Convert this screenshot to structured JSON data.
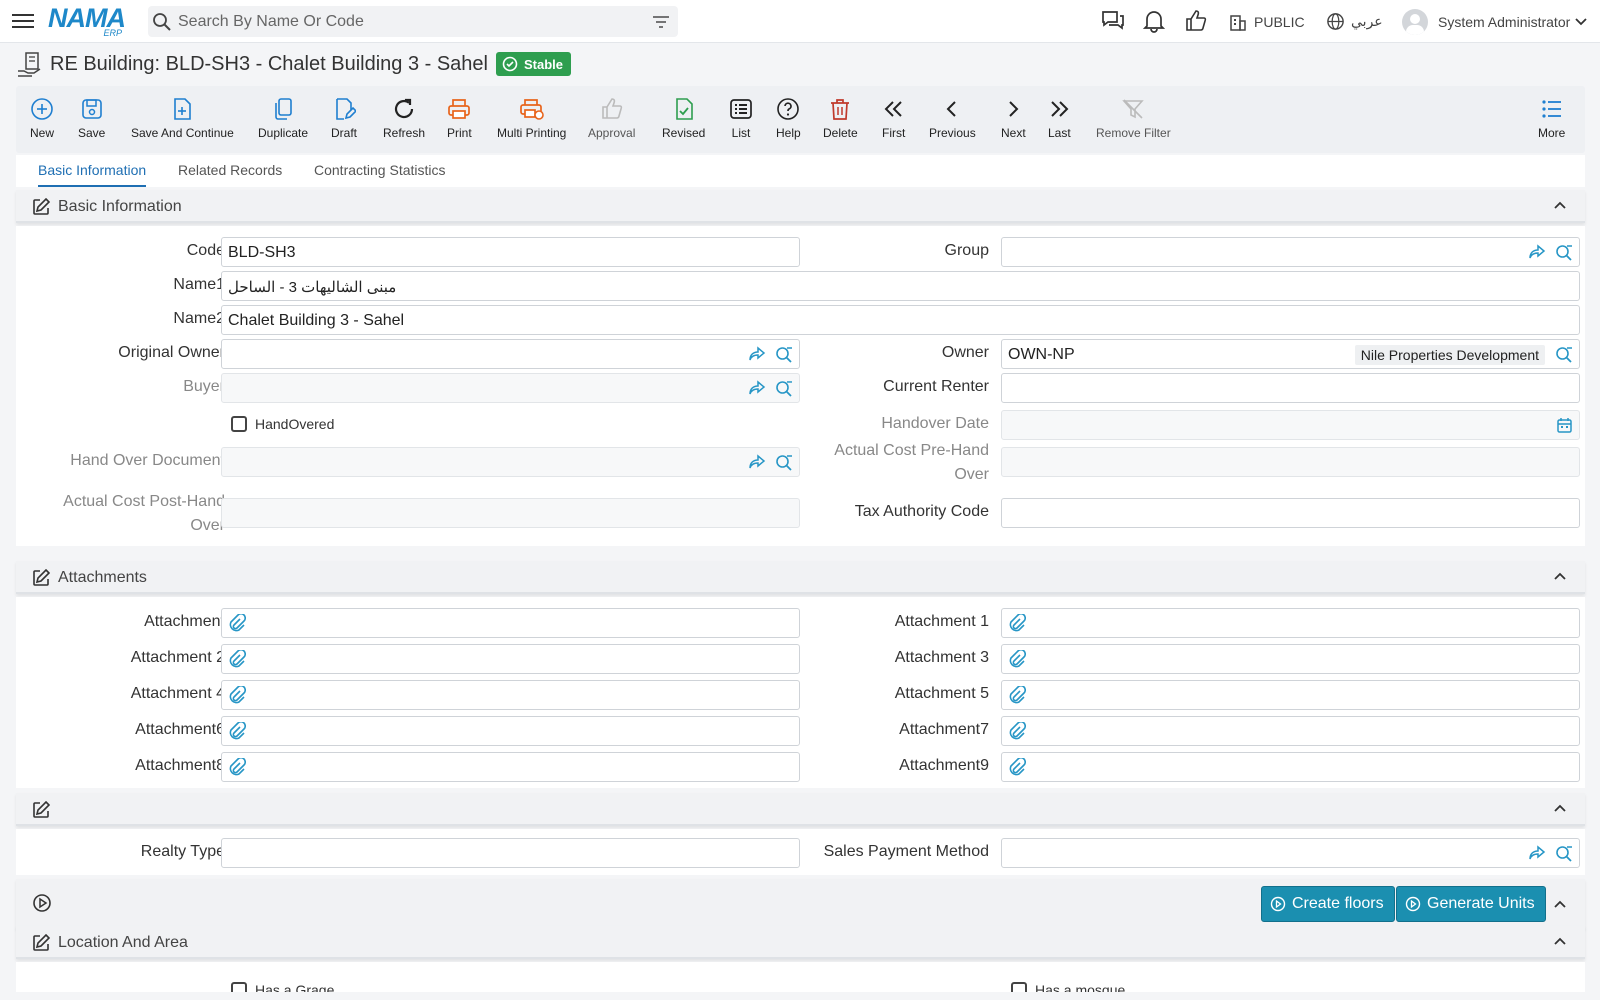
{
  "topbar": {
    "search_placeholder": "Search By Name Or Code",
    "logo": "NAMA",
    "logo_sub": "ERP",
    "branch": "PUBLIC",
    "language": "عربي",
    "user": "System Administrator"
  },
  "title": "RE Building: BLD-SH3 - Chalet Building 3 - Sahel",
  "status": "Stable",
  "toolbar": [
    {
      "label": "New",
      "icon": "plus-circle-icon"
    },
    {
      "label": "Save",
      "icon": "save-icon"
    },
    {
      "label": "Save And Continue",
      "icon": "file-plus-icon"
    },
    {
      "label": "Duplicate",
      "icon": "duplicate-icon"
    },
    {
      "label": "Draft",
      "icon": "draft-icon"
    },
    {
      "label": "Refresh",
      "icon": "refresh-icon"
    },
    {
      "label": "Print",
      "icon": "print-icon"
    },
    {
      "label": "Multi Printing",
      "icon": "multi-print-icon"
    },
    {
      "label": "Approval",
      "icon": "thumbs-up-icon"
    },
    {
      "label": "Revised",
      "icon": "revised-icon"
    },
    {
      "label": "List",
      "icon": "list-icon"
    },
    {
      "label": "Help",
      "icon": "help-icon"
    },
    {
      "label": "Delete",
      "icon": "trash-icon"
    },
    {
      "label": "First",
      "icon": "first-icon"
    },
    {
      "label": "Previous",
      "icon": "previous-icon"
    },
    {
      "label": "Next",
      "icon": "next-icon"
    },
    {
      "label": "Last",
      "icon": "last-icon"
    },
    {
      "label": "Remove Filter",
      "icon": "remove-filter-icon"
    },
    {
      "label": "More",
      "icon": "more-icon"
    }
  ],
  "tabs": [
    "Basic Information",
    "Related Records",
    "Contracting Statistics"
  ],
  "basic": {
    "section_title": "Basic Information",
    "code_label": "Code",
    "code": "BLD-SH3",
    "group_label": "Group",
    "name1_label": "Name1",
    "name1": "مبنى الشاليهات 3 - الساحل",
    "name2_label": "Name2",
    "name2": "Chalet Building 3 - Sahel",
    "original_owner_label": "Original Owner",
    "owner_label": "Owner",
    "owner": "OWN-NP",
    "owner_name": "Nile Properties Development",
    "buyer_label": "Buyer",
    "current_renter_label": "Current Renter",
    "handovered_label": "HandOvered",
    "handover_date_label": "Handover Date",
    "handover_doc_label": "Hand Over Document",
    "cost_pre_label_1": "Actual Cost Pre-Hand",
    "cost_pre_label_2": "Over",
    "cost_post_label_1": "Actual Cost Post-Hand",
    "cost_post_label_2": "Over",
    "tax_label": "Tax Authority Code"
  },
  "attachments": {
    "section_title": "Attachments",
    "labels": [
      "Attachment",
      "Attachment 1",
      "Attachment 2",
      "Attachment 3",
      "Attachment 4",
      "Attachment 5",
      "Attachment6",
      "Attachment7",
      "Attachment8",
      "Attachment9"
    ]
  },
  "misc": {
    "realty_type_label": "Realty Type",
    "sales_payment_label": "Sales Payment Method"
  },
  "actions": {
    "create_floors": "Create floors",
    "generate_units": "Generate Units"
  },
  "location": {
    "section_title": "Location And Area",
    "has_garage": "Has a Grage",
    "has_mosque": "Has a mosque"
  },
  "colors": {
    "accent": "#1f6fb3",
    "status_green": "#2e9e4f",
    "button_teal": "#1b8fb0",
    "orange": "#e8641b",
    "delete_red": "#c0392b"
  }
}
